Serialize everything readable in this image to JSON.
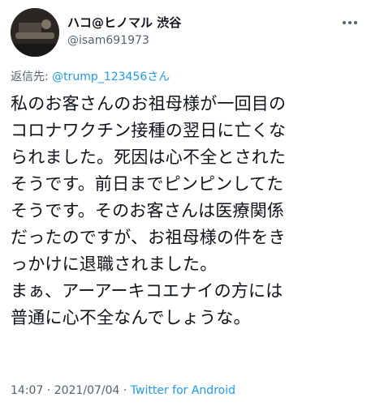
{
  "author": {
    "display_name": "ハコ@ヒノマル 渋谷",
    "handle": "@isam691973"
  },
  "reply": {
    "prefix": "返信先: ",
    "mention": "@trump_123456",
    "suffix": "さん"
  },
  "tweet": {
    "lines": [
      "私のお客さんのお祖母様が一回目の",
      "コロナワクチン接種の翌日に亡くな",
      "られました。死因は心不全とされた",
      "そうです。前日までピンピンしてた",
      "そうです。そのお客さんは医療関係",
      "だったのですが、お祖母様の件をき",
      "っかけに退職されました。",
      "まぁ、アーアーキコエナイの方には",
      "普通に心不全なんでしょうな。"
    ]
  },
  "meta": {
    "time": "14:07",
    "separator1": " · ",
    "date": "2021/07/04",
    "separator2": " · ",
    "source": "Twitter for Android"
  },
  "icons": {
    "more": "more-horizontal-icon",
    "avatar": "avatar-photo"
  },
  "colors": {
    "text": "#0f1419",
    "secondary": "#536471",
    "link": "#1d9bf0"
  }
}
